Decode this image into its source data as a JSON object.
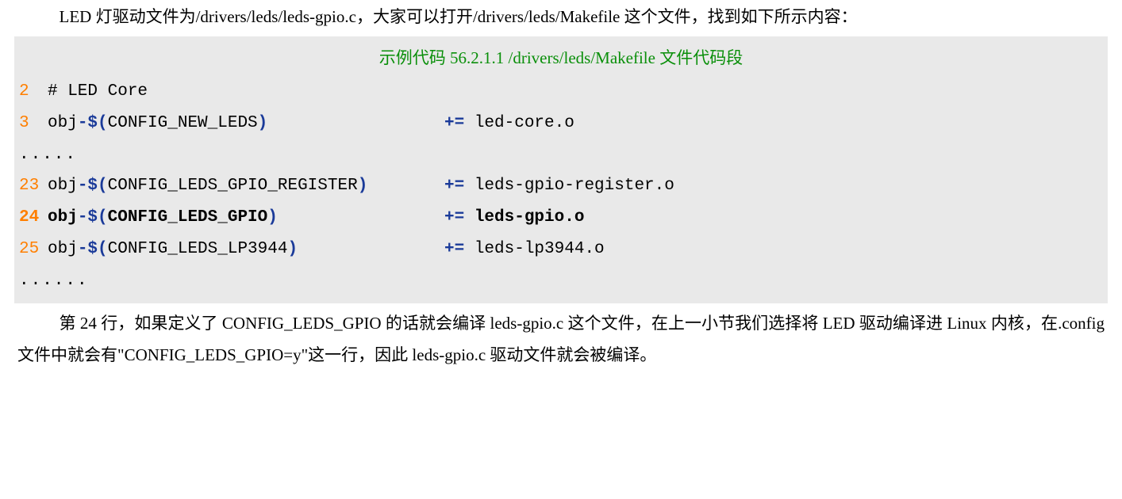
{
  "para1": "LED 灯驱动文件为/drivers/leds/leds-gpio.c，大家可以打开/drivers/leds/Makefile 这个文件，找到如下所示内容：",
  "caption": "示例代码 56.2.1.1 /drivers/leds/Makefile 文件代码段",
  "lines": {
    "l2": {
      "num": "2",
      "left": "# LED Core",
      "right": ""
    },
    "l3": {
      "num": "3",
      "left_a": "obj",
      "left_b": "-$(",
      "left_c": "CONFIG_NEW_LEDS",
      "left_d": ")",
      "right_op": "+=",
      "right_txt": " led-core.o"
    },
    "dots1": ".....",
    "l23": {
      "num": "23",
      "left_a": "obj",
      "left_b": "-$(",
      "left_c": "CONFIG_LEDS_GPIO_REGISTER",
      "left_d": ")",
      "right_op": "+=",
      "right_txt": " leds-gpio-register.o"
    },
    "l24": {
      "num": "24",
      "left_a": "obj",
      "left_b": "-$(",
      "left_c": "CONFIG_LEDS_GPIO",
      "left_d": ")",
      "right_op": "+=",
      "right_txt": " leds-gpio.o"
    },
    "l25": {
      "num": "25",
      "left_a": "obj",
      "left_b": "-$(",
      "left_c": "CONFIG_LEDS_LP3944",
      "left_d": ")",
      "right_op": "+=",
      "right_txt": " leds-lp3944.o"
    },
    "dots2": "......"
  },
  "para2": "第 24 行，如果定义了 CONFIG_LEDS_GPIO 的话就会编译 leds-gpio.c 这个文件，在上一小节我们选择将 LED 驱动编译进 Linux 内核，在.config 文件中就会有\"CONFIG_LEDS_GPIO=y\"这一行，因此 leds-gpio.c 驱动文件就会被编译。"
}
